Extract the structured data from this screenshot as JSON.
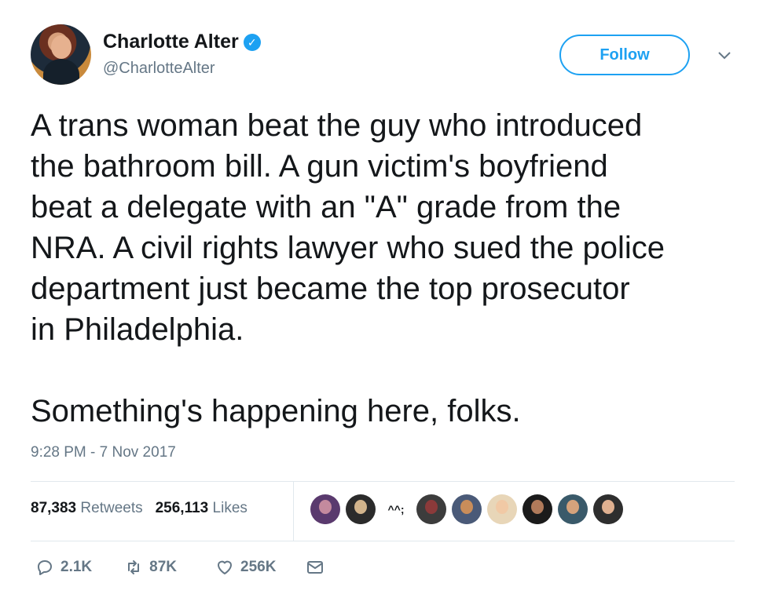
{
  "author": {
    "name": "Charlotte Alter",
    "handle": "@CharlotteAlter",
    "verified": true
  },
  "follow_button": {
    "label": "Follow"
  },
  "tweet": {
    "text": "A trans woman beat the guy who introduced\nthe bathroom bill. A gun victim's boyfriend\nbeat a delegate with an \"A\" grade from the\nNRA. A civil rights lawyer who sued the police\ndepartment just became the top prosecutor\nin Philadelphia.\n\nSomething's happening here, folks.",
    "timestamp": "9:28 PM - 7 Nov 2017"
  },
  "stats": {
    "retweets_count": "87,383",
    "retweets_label": "Retweets",
    "likes_count": "256,113",
    "likes_label": "Likes"
  },
  "likers": [
    {
      "type": "avatar",
      "colors": [
        "#c48a9e",
        "#5a3a6e"
      ]
    },
    {
      "type": "avatar",
      "colors": [
        "#d2b48c",
        "#2b2b2b"
      ]
    },
    {
      "type": "text",
      "label": "^^;"
    },
    {
      "type": "avatar",
      "colors": [
        "#8b3a3a",
        "#3c3c3c"
      ]
    },
    {
      "type": "avatar",
      "colors": [
        "#c98d5a",
        "#4a5a78"
      ]
    },
    {
      "type": "avatar",
      "colors": [
        "#f1c9a5",
        "#e8d6b8"
      ]
    },
    {
      "type": "avatar",
      "colors": [
        "#b07a5a",
        "#1b1b1b"
      ]
    },
    {
      "type": "avatar",
      "colors": [
        "#d6a37c",
        "#3a5a6a"
      ]
    },
    {
      "type": "avatar",
      "colors": [
        "#e0b090",
        "#2e2e2e"
      ]
    }
  ],
  "actions": {
    "reply_count": "2.1K",
    "retweet_count": "87K",
    "like_count": "256K"
  },
  "colors": {
    "accent": "#1da1f2",
    "text": "#14171a",
    "muted": "#657786",
    "divider": "#e1e8ed"
  }
}
